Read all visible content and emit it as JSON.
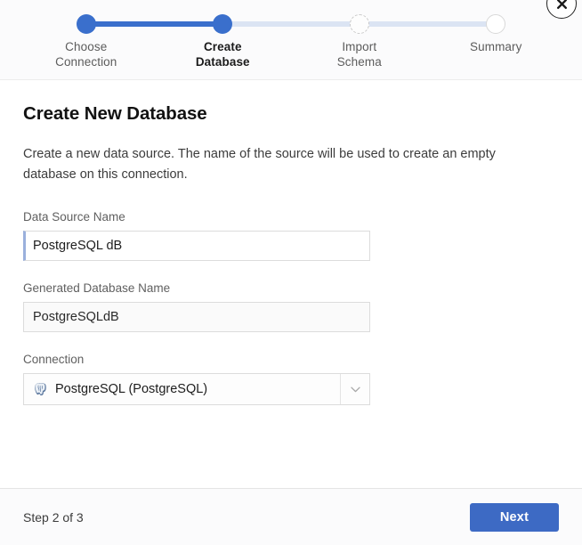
{
  "dialog": {
    "close_label": "×"
  },
  "stepper": {
    "steps": [
      {
        "label": "Choose\nConnection",
        "state": "done"
      },
      {
        "label": "Create\nDatabase",
        "state": "active"
      },
      {
        "label": "Import\nSchema",
        "state": "next"
      },
      {
        "label": "Summary",
        "state": "todo"
      }
    ]
  },
  "main": {
    "title": "Create New Database",
    "description": "Create a new data source. The name of the source will be used to create an empty database on this connection.",
    "fields": {
      "data_source_name": {
        "label": "Data Source Name",
        "value": "PostgreSQL dB",
        "placeholder": ""
      },
      "generated_database_name": {
        "label": "Generated Database Name",
        "value": "PostgreSQLdB",
        "placeholder": ""
      },
      "connection": {
        "label": "Connection",
        "value": "PostgreSQL (PostgreSQL)",
        "icon": "postgresql-icon",
        "chevron": "chevron-down-icon"
      }
    }
  },
  "footer": {
    "step_counter": "Step 2 of 3",
    "next_label": "Next"
  },
  "colors": {
    "accent": "#3a6fcc",
    "button": "#3d6ac4",
    "bar_pale": "#dbe4f3",
    "panel": "#fbfbfc"
  }
}
